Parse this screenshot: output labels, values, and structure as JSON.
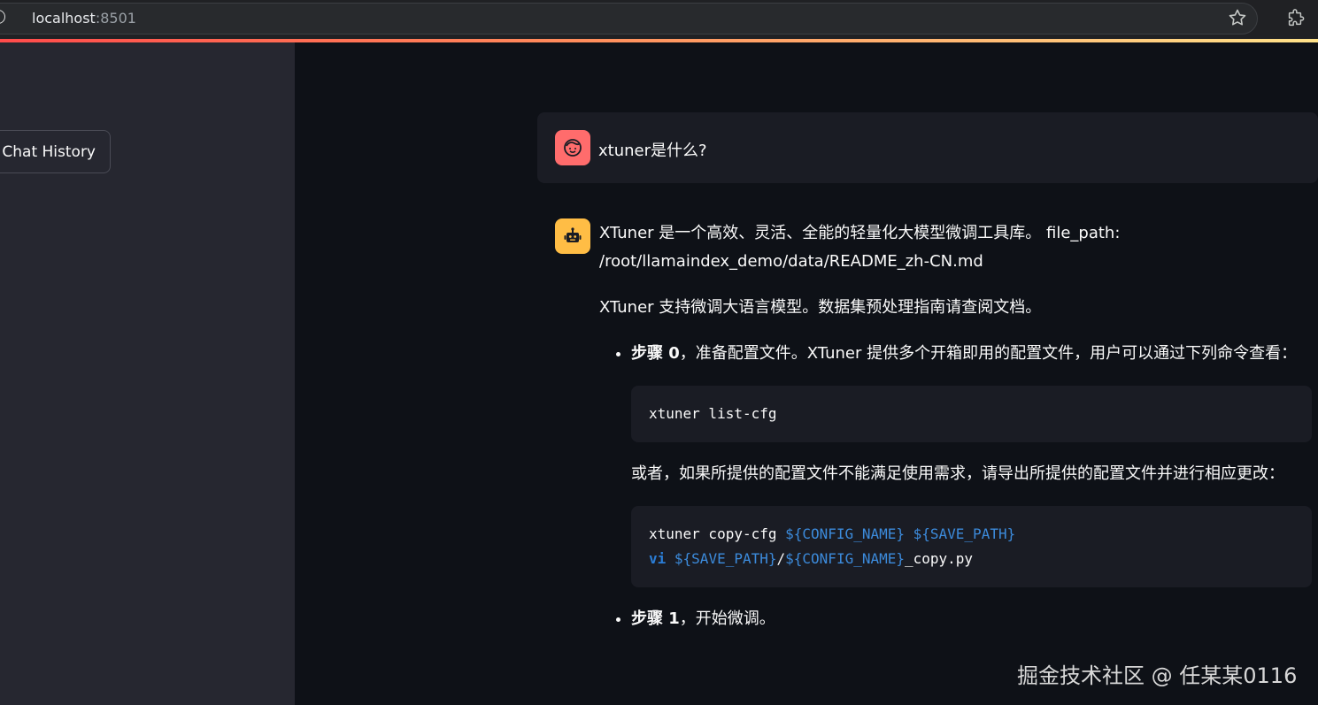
{
  "browser": {
    "url_host": "localhost",
    "url_port": ":8501"
  },
  "sidebar": {
    "clear_button_label": "r Chat History"
  },
  "chat": {
    "user_message": "xtuner是什么?",
    "bot": {
      "line1": "XTuner 是一个高效、灵活、全能的轻量化大模型微调工具库。 file_path: /root/llamaindex_demo/data/README_zh-CN.md",
      "line2": "XTuner 支持微调大语言模型。数据集预处理指南请查阅文档。",
      "step0_bold": "步骤 0",
      "step0_text": "，准备配置文件。XTuner 提供多个开箱即用的配置文件，用户可以通过下列命令查看：",
      "code1": "xtuner list-cfg",
      "step0_more": "或者，如果所提供的配置文件不能满足使用需求，请导出所提供的配置文件并进行相应更改：",
      "code2_line1_cmd": "xtuner copy-cfg ",
      "code2_line1_var1": "${CONFIG_NAME}",
      "code2_line1_sp": " ",
      "code2_line1_var2": "${SAVE_PATH}",
      "code2_line2_kw": "vi",
      "code2_line2_sp": " ",
      "code2_line2_var1": "${SAVE_PATH}",
      "code2_line2_slash": "/",
      "code2_line2_var2": "${CONFIG_NAME}",
      "code2_line2_suffix": "_copy.py",
      "step1_bold": "步骤 1",
      "step1_text": "，开始微调。"
    }
  },
  "watermark": "掘金技术社区 @ 任某某0116",
  "colors": {
    "background": "#0e1117",
    "sidebar": "#262730",
    "user_avatar": "#ff6c6c",
    "bot_avatar": "#ffbd45",
    "code_var": "#3c8bdc"
  }
}
